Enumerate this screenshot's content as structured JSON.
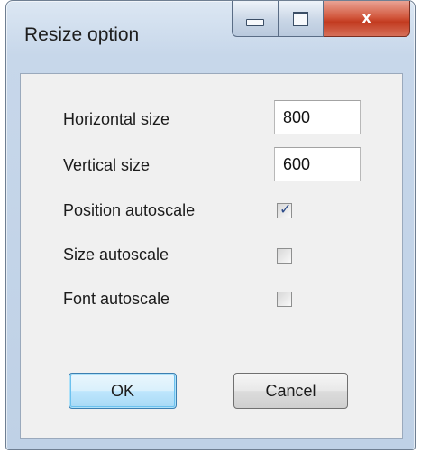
{
  "window": {
    "title": "Resize option",
    "close_glyph": "x",
    "close_color": "#c8412a"
  },
  "form": {
    "horizontal_size_label": "Horizontal size",
    "horizontal_size_value": "800",
    "vertical_size_label": "Vertical size",
    "vertical_size_value": "600",
    "position_autoscale_label": "Position autoscale",
    "position_autoscale_checked": true,
    "size_autoscale_label": "Size autoscale",
    "size_autoscale_checked": false,
    "font_autoscale_label": "Font autoscale",
    "font_autoscale_checked": false
  },
  "buttons": {
    "ok_label": "OK",
    "cancel_label": "Cancel"
  },
  "icons": {
    "minimize": "minimize-icon",
    "maximize": "maximize-icon",
    "close": "close-icon",
    "check": "checkmark-icon"
  }
}
